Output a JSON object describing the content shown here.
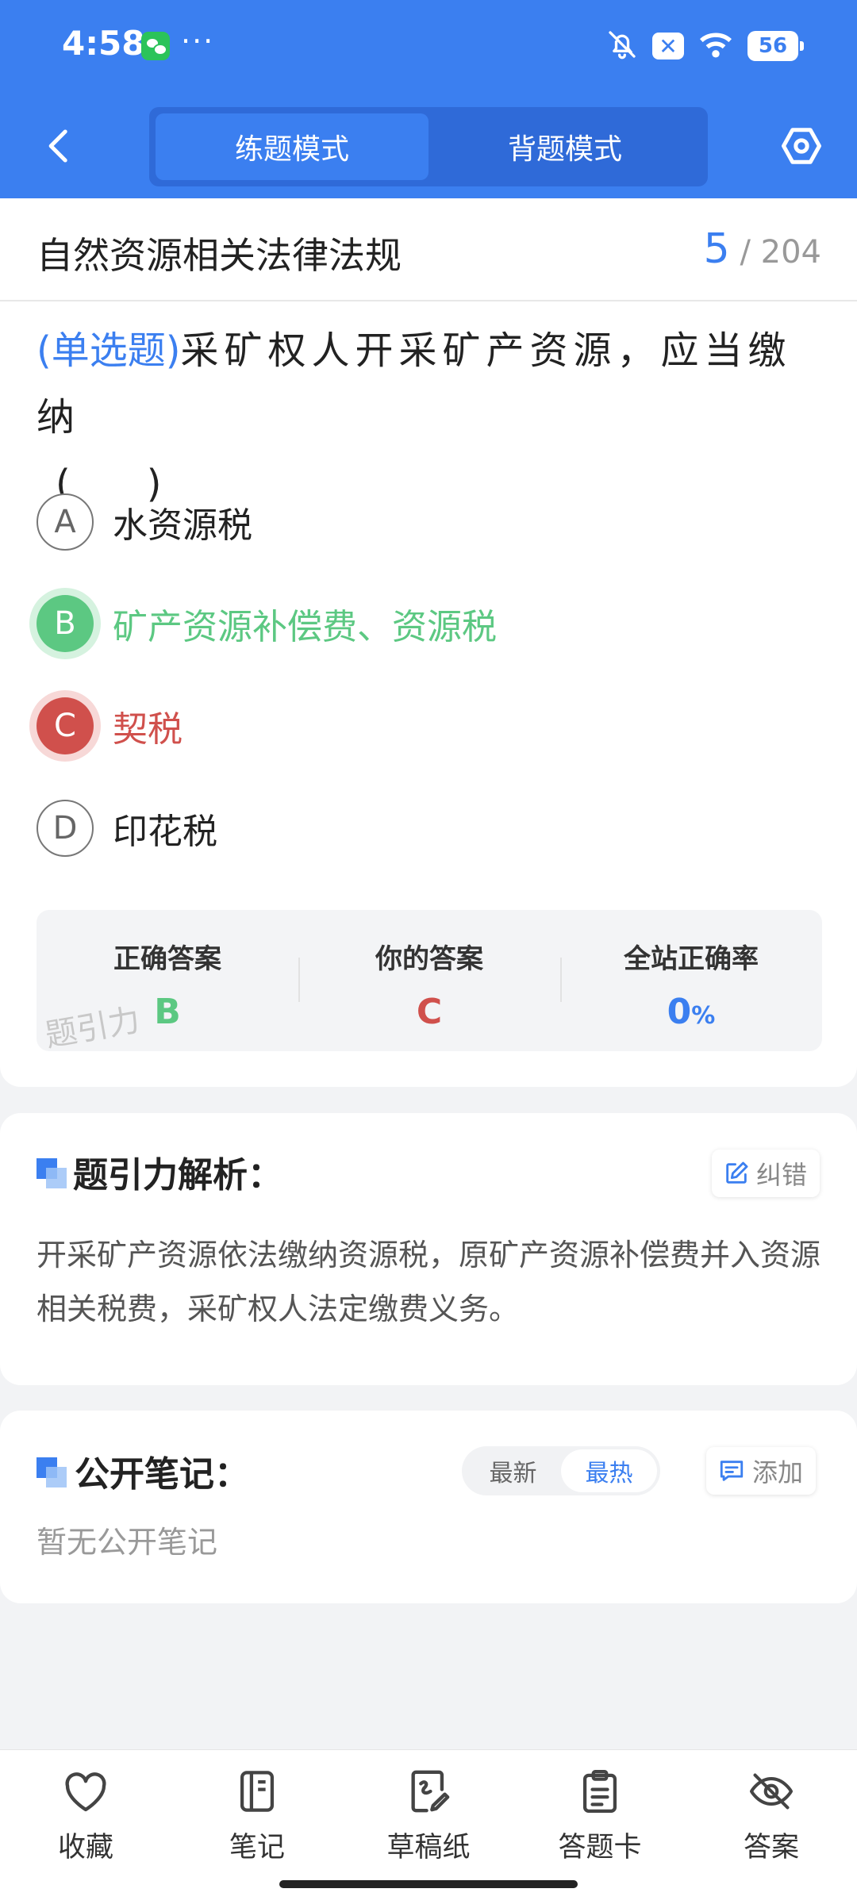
{
  "status_bar": {
    "time": "4:58",
    "more": "···",
    "battery": "56",
    "notif_x": "✕"
  },
  "nav": {
    "modes": [
      "练题模式",
      "背题模式"
    ],
    "active_mode": 0
  },
  "question": {
    "chapter": "自然资源相关法律法规",
    "current": "5",
    "total": "/ 204",
    "type": "(单选题)",
    "stem": "采矿权人开采矿产资源，应当缴纳",
    "blank": "(　　)",
    "options": [
      {
        "letter": "A",
        "text": "水资源税",
        "state": "normal"
      },
      {
        "letter": "B",
        "text": "矿产资源补偿费、资源税",
        "state": "correct"
      },
      {
        "letter": "C",
        "text": "契税",
        "state": "wrong"
      },
      {
        "letter": "D",
        "text": "印花税",
        "state": "normal"
      }
    ]
  },
  "result": {
    "correct_label": "正确答案",
    "correct_value": "B",
    "yours_label": "你的答案",
    "yours_value": "C",
    "rate_label": "全站正确率",
    "rate_value": "0",
    "rate_unit": "%",
    "watermark": "题引力"
  },
  "analysis": {
    "title": "题引力解析：",
    "report_label": "纠错",
    "text": "开采矿产资源依法缴纳资源税，原矿产资源补偿费并入资源相关税费，采矿权人法定缴费义务。"
  },
  "notes": {
    "title": "公开笔记：",
    "sort_options": [
      "最新",
      "最热"
    ],
    "active_sort": 1,
    "add_label": "添加",
    "empty_text": "暂无公开笔记"
  },
  "bottom_bar": {
    "items": [
      {
        "label": "收藏",
        "icon": "heart-icon"
      },
      {
        "label": "笔记",
        "icon": "notebook-icon"
      },
      {
        "label": "草稿纸",
        "icon": "draft-paper-icon"
      },
      {
        "label": "答题卡",
        "icon": "answer-sheet-icon"
      },
      {
        "label": "答案",
        "icon": "eye-off-icon"
      }
    ]
  },
  "colors": {
    "primary": "#3b7ff0",
    "correct": "#5cc882",
    "wrong": "#d0504c"
  }
}
